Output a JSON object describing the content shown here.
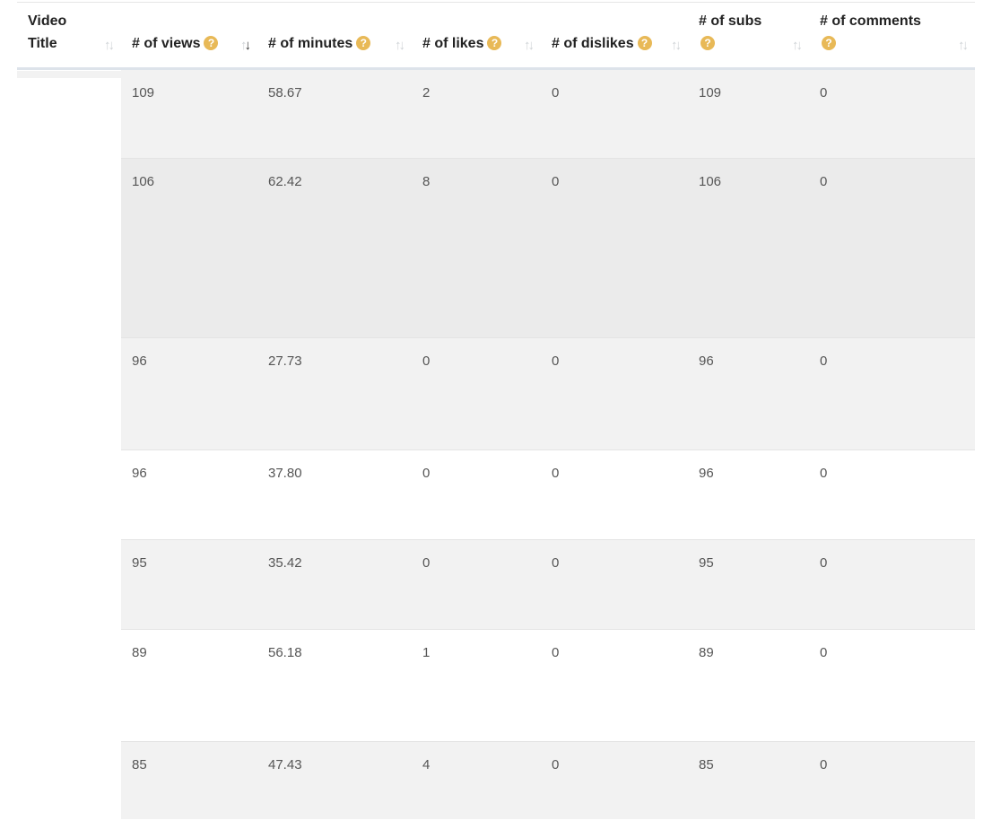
{
  "table": {
    "columns": [
      {
        "line1": "Video",
        "line2": "Title",
        "help": false
      },
      {
        "label": "# of views",
        "help": true,
        "sorted": "desc"
      },
      {
        "label": "# of minutes",
        "help": true
      },
      {
        "label": "# of likes",
        "help": true
      },
      {
        "label": "# of dislikes",
        "help": true
      },
      {
        "label": "# of subs",
        "help": true
      },
      {
        "label": "# of comments",
        "help": true
      }
    ],
    "help_glyph": "?",
    "sort_glyph_up": "↑",
    "sort_glyph_down": "↓",
    "rows": [
      {
        "title": "",
        "views": "109",
        "minutes": "58.67",
        "likes": "2",
        "dislikes": "0",
        "subs": "109",
        "comments": "0"
      },
      {
        "title": "",
        "views": "106",
        "minutes": "62.42",
        "likes": "8",
        "dislikes": "0",
        "subs": "106",
        "comments": "0"
      },
      {
        "title": "",
        "views": "96",
        "minutes": "27.73",
        "likes": "0",
        "dislikes": "0",
        "subs": "96",
        "comments": "0"
      },
      {
        "title": "",
        "views": "96",
        "minutes": "37.80",
        "likes": "0",
        "dislikes": "0",
        "subs": "96",
        "comments": "0"
      },
      {
        "title": "",
        "views": "95",
        "minutes": "35.42",
        "likes": "0",
        "dislikes": "0",
        "subs": "95",
        "comments": "0"
      },
      {
        "title": "",
        "views": "89",
        "minutes": "56.18",
        "likes": "1",
        "dislikes": "0",
        "subs": "89",
        "comments": "0"
      },
      {
        "title": "",
        "views": "85",
        "minutes": "47.43",
        "likes": "4",
        "dislikes": "0",
        "subs": "85",
        "comments": "0"
      }
    ]
  },
  "colors": {
    "help_icon": "#e8b957",
    "row_stripe": "#f2f2f2",
    "row_hover": "#ebebeb",
    "header_border": "#dde3ea"
  }
}
